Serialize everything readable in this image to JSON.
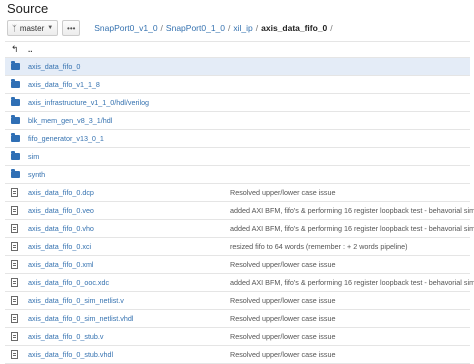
{
  "page": {
    "title": "Source"
  },
  "toolbar": {
    "branch_label": "master",
    "more_label": "•••"
  },
  "breadcrumb": {
    "items": [
      "SnapPort0_v1_0",
      "SnapPort0_1_0",
      "xil_ip"
    ],
    "current": "axis_data_fifo_0"
  },
  "parent_link": "..",
  "entries": [
    {
      "type": "folder",
      "name": "axis_data_fifo_0",
      "message": ""
    },
    {
      "type": "folder",
      "name": "axis_data_fifo_v1_1_8",
      "message": ""
    },
    {
      "type": "folder",
      "name": "axis_infrastructure_v1_1_0/hdl/verilog",
      "message": ""
    },
    {
      "type": "folder",
      "name": "blk_mem_gen_v8_3_1/hdl",
      "message": ""
    },
    {
      "type": "folder",
      "name": "fifo_generator_v13_0_1",
      "message": ""
    },
    {
      "type": "folder",
      "name": "sim",
      "message": ""
    },
    {
      "type": "folder",
      "name": "synth",
      "message": ""
    },
    {
      "type": "file",
      "name": "axis_data_fifo_0.dcp",
      "message": "Resolved upper/lower case issue"
    },
    {
      "type": "file",
      "name": "axis_data_fifo_0.veo",
      "message": "added AXI BFM, fifo's & performing 16 register loopback test - behavorial sim ok"
    },
    {
      "type": "file",
      "name": "axis_data_fifo_0.vho",
      "message": "added AXI BFM, fifo's & performing 16 register loopback test - behavorial sim ok"
    },
    {
      "type": "file",
      "name": "axis_data_fifo_0.xci",
      "message": "resized fifo to 64 words (remember : + 2 words pipeline)"
    },
    {
      "type": "file",
      "name": "axis_data_fifo_0.xml",
      "message": "Resolved upper/lower case issue"
    },
    {
      "type": "file",
      "name": "axis_data_fifo_0_ooc.xdc",
      "message": "added AXI BFM, fifo's & performing 16 register loopback test - behavorial sim ok"
    },
    {
      "type": "file",
      "name": "axis_data_fifo_0_sim_netlist.v",
      "message": "Resolved upper/lower case issue"
    },
    {
      "type": "file",
      "name": "axis_data_fifo_0_sim_netlist.vhdl",
      "message": "Resolved upper/lower case issue"
    },
    {
      "type": "file",
      "name": "axis_data_fifo_0_stub.v",
      "message": "Resolved upper/lower case issue"
    },
    {
      "type": "file",
      "name": "axis_data_fifo_0_stub.vhdl",
      "message": "Resolved upper/lower case issue"
    }
  ],
  "selected_index": 0
}
